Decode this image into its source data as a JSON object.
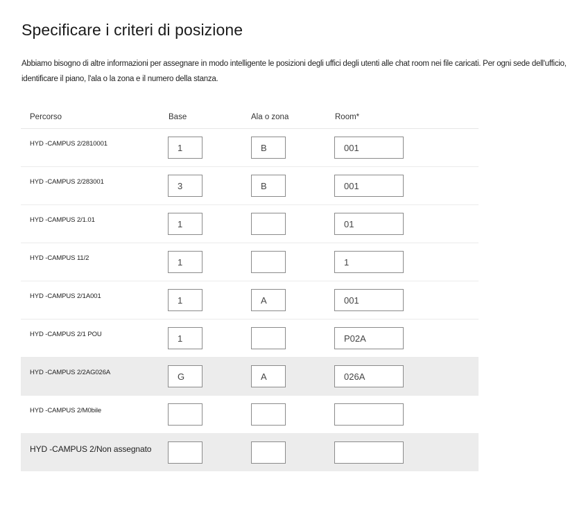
{
  "title": "Specificare i criteri di posizione",
  "description": "Abbiamo bisogno di altre informazioni per assegnare in modo intelligente le posizioni degli uffici degli utenti alle chat room nei file caricati. Per ogni sede dell'ufficio, identificare il piano, l'ala o la zona e il numero della stanza.",
  "table": {
    "headers": [
      "Percorso",
      "Base",
      "Ala o zona",
      "Room*"
    ],
    "rows": [
      {
        "path": "HYD -CAMPUS 2/2810001",
        "base": "1",
        "zone": "B",
        "room": "001"
      },
      {
        "path": "HYD -CAMPUS 2/283001",
        "base": "3",
        "zone": "B",
        "room": "001"
      },
      {
        "path": "HYD -CAMPUS 2/1.01",
        "base": "1",
        "zone": "",
        "room": "01"
      },
      {
        "path": "HYD -CAMPUS 11/2",
        "base": "1",
        "zone": "",
        "room": "1"
      },
      {
        "path": "HYD -CAMPUS 2/1A001",
        "base": "1",
        "zone": "A",
        "room": "001"
      },
      {
        "path": "HYD -CAMPUS 2/1 POU",
        "base": "1",
        "zone": "",
        "room": "P02A"
      },
      {
        "path": "HYD -CAMPUS 2/2AG026A",
        "base": "G",
        "zone": "A",
        "room": "026A"
      },
      {
        "path": "HYD -CAMPUS 2/M0bile",
        "base": "",
        "zone": "",
        "room": ""
      },
      {
        "path": "HYD -CAMPUS 2/Non assegnato",
        "base": "",
        "zone": "",
        "room": ""
      }
    ]
  }
}
